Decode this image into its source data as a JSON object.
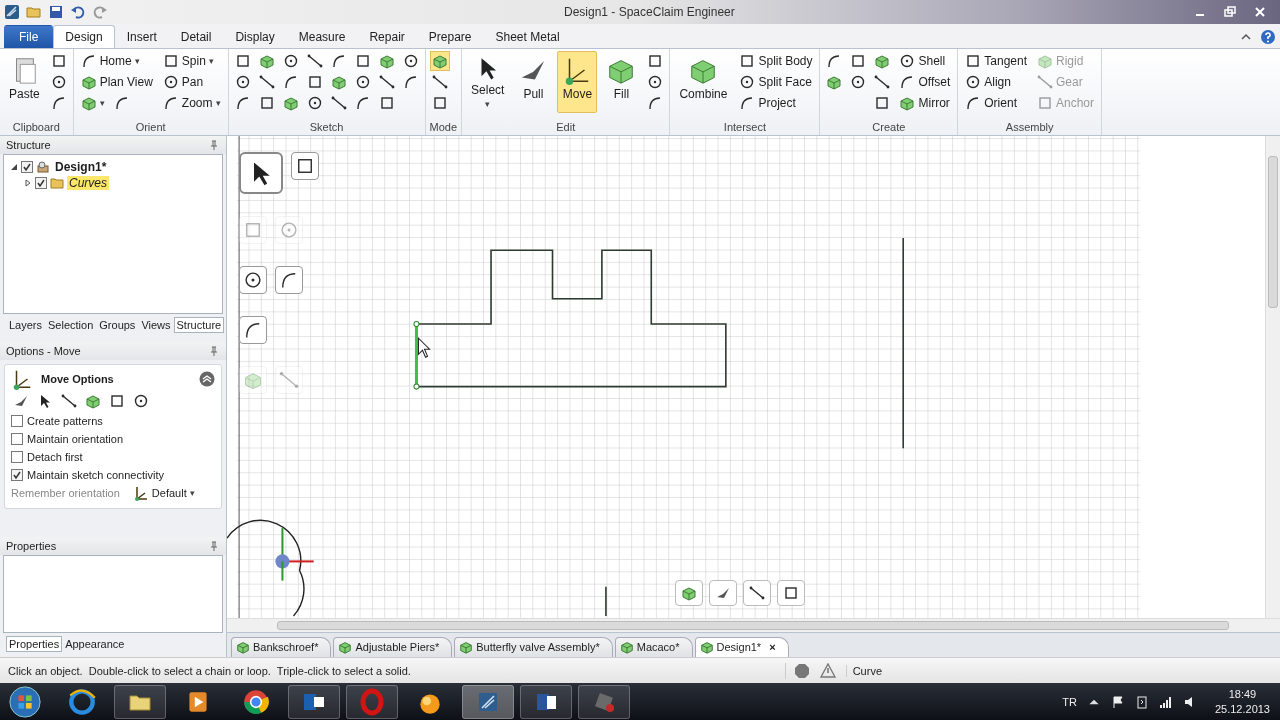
{
  "window": {
    "title": "Design1 - SpaceClaim Engineer"
  },
  "ribbon": {
    "tabs": [
      {
        "label": "File",
        "kind": "file",
        "selected": false
      },
      {
        "label": "Design",
        "kind": "tab",
        "selected": true
      },
      {
        "label": "Insert",
        "kind": "tab",
        "selected": false
      },
      {
        "label": "Detail",
        "kind": "tab",
        "selected": false
      },
      {
        "label": "Display",
        "kind": "tab",
        "selected": false
      },
      {
        "label": "Measure",
        "kind": "tab",
        "selected": false
      },
      {
        "label": "Repair",
        "kind": "tab",
        "selected": false
      },
      {
        "label": "Prepare",
        "kind": "tab",
        "selected": false
      },
      {
        "label": "Sheet Metal",
        "kind": "tab",
        "selected": false
      }
    ],
    "groups": [
      {
        "label": "Clipboard",
        "items": [
          {
            "kind": "large",
            "label": "Paste"
          },
          {
            "kind": "tool"
          },
          {
            "kind": "tool"
          },
          {
            "kind": "tool"
          }
        ]
      },
      {
        "label": "Orient",
        "items": [
          {
            "kind": "small",
            "label": "Home",
            "caret": "▾"
          },
          {
            "kind": "small",
            "label": "Plan View"
          },
          {
            "kind": "pair",
            "caret": "▾"
          },
          {
            "kind": "small",
            "label": "Spin",
            "caret": "▾"
          },
          {
            "kind": "small",
            "label": "Pan"
          },
          {
            "kind": "small",
            "label": "Zoom",
            "caret": "▾"
          }
        ]
      },
      {
        "label": "Sketch",
        "items": [
          {
            "kind": "tool"
          },
          {
            "kind": "tool"
          },
          {
            "kind": "tool"
          },
          {
            "kind": "tool"
          },
          {
            "kind": "tool"
          },
          {
            "kind": "tool"
          },
          {
            "kind": "tool"
          },
          {
            "kind": "tool"
          },
          {
            "kind": "tool"
          },
          {
            "kind": "tool"
          },
          {
            "kind": "tool"
          },
          {
            "kind": "tool"
          },
          {
            "kind": "tool"
          },
          {
            "kind": "tool"
          },
          {
            "kind": "tool"
          },
          {
            "kind": "tool"
          },
          {
            "kind": "tool"
          },
          {
            "kind": "tool"
          },
          {
            "kind": "tool"
          },
          {
            "kind": "tool"
          },
          {
            "kind": "tool"
          },
          {
            "kind": "tool"
          },
          {
            "kind": "tool"
          }
        ]
      },
      {
        "label": "Mode",
        "items": [
          {
            "kind": "tool",
            "selected": true
          },
          {
            "kind": "tool",
            "selected": false
          },
          {
            "kind": "tool",
            "selected": false
          }
        ]
      },
      {
        "label": "Edit",
        "items": [
          {
            "kind": "large",
            "label": "Select",
            "caret": "▾",
            "selected": false
          },
          {
            "kind": "large",
            "label": "Pull",
            "selected": false
          },
          {
            "kind": "large",
            "label": "Move",
            "selected": true
          },
          {
            "kind": "large",
            "label": "Fill",
            "selected": false
          },
          {
            "kind": "tool",
            "selected": false
          },
          {
            "kind": "tool",
            "selected": false
          },
          {
            "kind": "tool",
            "selected": false
          }
        ]
      },
      {
        "label": "Intersect",
        "items": [
          {
            "kind": "large",
            "label": "Combine"
          },
          {
            "kind": "small",
            "label": "Split Body"
          },
          {
            "kind": "small",
            "label": "Split Face"
          },
          {
            "kind": "small",
            "label": "Project"
          }
        ]
      },
      {
        "label": "Create",
        "items": [
          {
            "kind": "tool"
          },
          {
            "kind": "tool"
          },
          {
            "kind": "blank"
          },
          {
            "kind": "tool"
          },
          {
            "kind": "tool"
          },
          {
            "kind": "blank"
          },
          {
            "kind": "tool"
          },
          {
            "kind": "tool"
          },
          {
            "kind": "tool"
          },
          {
            "kind": "small",
            "label": "Shell"
          },
          {
            "kind": "small",
            "label": "Offset"
          },
          {
            "kind": "small",
            "label": "Mirror"
          }
        ]
      },
      {
        "label": "Assembly",
        "items": [
          {
            "kind": "small",
            "label": "Tangent",
            "disabled": false
          },
          {
            "kind": "small",
            "label": "Align",
            "disabled": false
          },
          {
            "kind": "small",
            "label": "Orient",
            "disabled": false
          },
          {
            "kind": "small",
            "label": "Rigid",
            "disabled": true
          },
          {
            "kind": "small",
            "label": "Gear",
            "disabled": true
          },
          {
            "kind": "small",
            "label": "Anchor",
            "disabled": true
          }
        ]
      }
    ]
  },
  "structure_panel": {
    "title": "Structure",
    "tree": [
      {
        "label": "Design1*",
        "checked": true,
        "expanded": true,
        "selected": false,
        "children": [
          {
            "label": "Curves",
            "checked": true,
            "expanded": false,
            "selected": true
          }
        ]
      }
    ]
  },
  "panel_tabs": [
    {
      "label": "Layers",
      "selected": false
    },
    {
      "label": "Selection",
      "selected": false
    },
    {
      "label": "Groups",
      "selected": false
    },
    {
      "label": "Views",
      "selected": false
    },
    {
      "label": "Structure",
      "selected": true
    }
  ],
  "options_panel": {
    "title": "Options - Move",
    "heading": "Move Options",
    "options": [
      {
        "label": "Create patterns",
        "checked": false
      },
      {
        "label": "Maintain orientation",
        "checked": false
      },
      {
        "label": "Detach first",
        "checked": false
      },
      {
        "label": "Maintain sketch connectivity",
        "checked": true
      }
    ],
    "orientation_label": "Remember orientation",
    "orientation_value": "Default",
    "orientation_caret": "▾"
  },
  "properties_panel": {
    "title": "Properties"
  },
  "bottom_tabs": [
    {
      "label": "Properties",
      "selected": true
    },
    {
      "label": "Appearance",
      "selected": false
    }
  ],
  "canvas": {
    "palette": [
      {
        "tools": [
          {
            "selected": true,
            "disabled": false
          },
          {
            "selected": false,
            "disabled": false
          }
        ]
      },
      {
        "tools": [
          {
            "selected": false,
            "disabled": true
          },
          {
            "selected": false,
            "disabled": true
          }
        ]
      },
      {
        "tools": [
          {
            "selected": false,
            "disabled": false
          },
          {
            "selected": false,
            "disabled": false
          }
        ]
      },
      {
        "tools": [
          {
            "selected": false,
            "disabled": false
          }
        ]
      },
      {
        "tools": [
          {
            "selected": false,
            "disabled": true
          },
          {
            "selected": false,
            "disabled": true
          }
        ]
      }
    ]
  },
  "doc_tabs": [
    {
      "label": "Bankschroef*",
      "selected": false
    },
    {
      "label": "Adjustable Piers*",
      "selected": false
    },
    {
      "label": "Butterfly valve Assembly*",
      "selected": false
    },
    {
      "label": "Macaco*",
      "selected": false
    },
    {
      "label": "Design1*",
      "selected": true,
      "close": "×"
    }
  ],
  "status_bar": {
    "message": "Click an object.  Double-click to select a chain or loop.  Triple-click to select a solid.",
    "mode": "Curve"
  },
  "taskbar": {
    "language": "TR",
    "time": "18:49",
    "date": "25.12.2013"
  }
}
